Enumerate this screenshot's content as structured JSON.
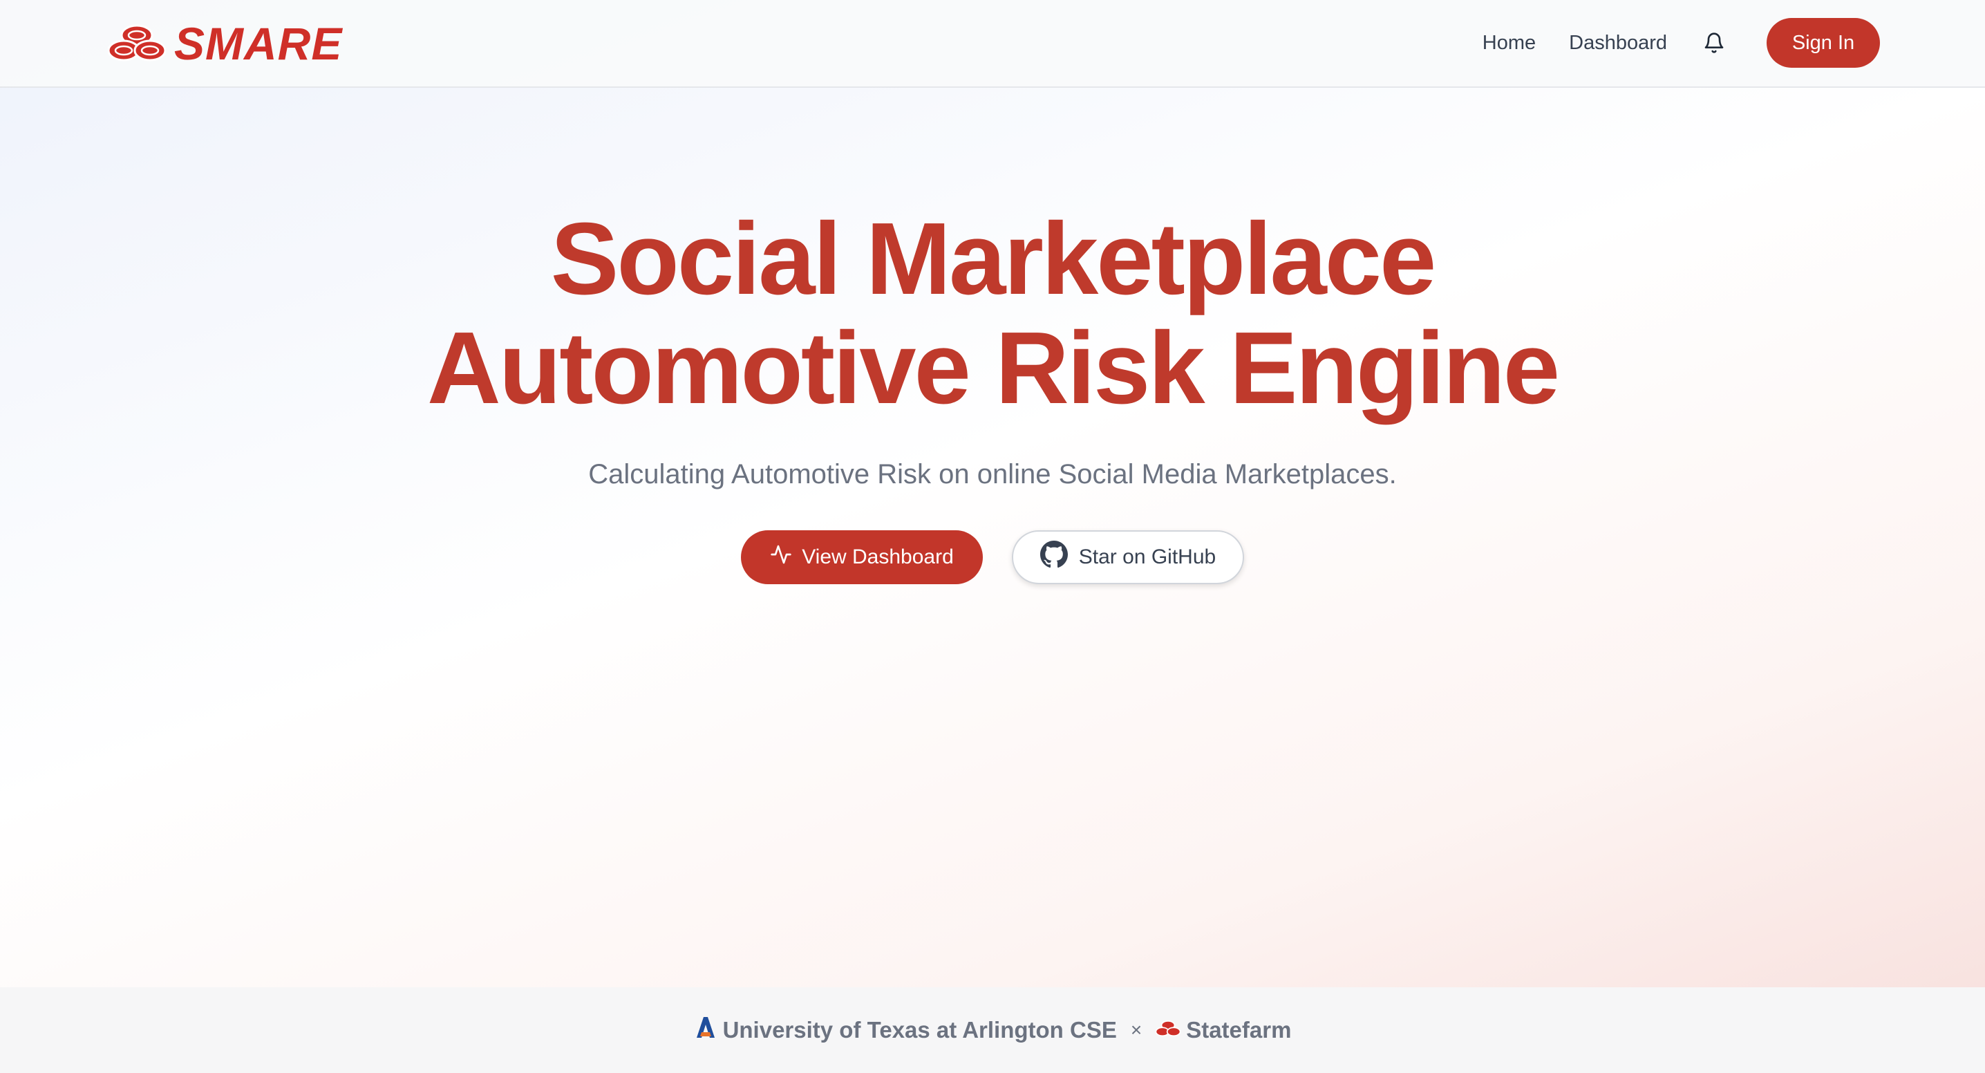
{
  "header": {
    "logo_text": "SMARE",
    "logo_icon": "statefarm-ovals-icon",
    "nav": [
      {
        "label": "Home"
      },
      {
        "label": "Dashboard"
      }
    ],
    "bell_icon": "bell-icon",
    "sign_in_label": "Sign In"
  },
  "hero": {
    "title_line1": "Social Marketplace",
    "title_line2": "Automotive Risk Engine",
    "subtitle": "Calculating Automotive Risk on online Social Media Marketplaces.",
    "primary_button": {
      "label": "View Dashboard",
      "icon": "activity-pulse-icon"
    },
    "secondary_button": {
      "label": "Star on GitHub",
      "icon": "github-icon"
    }
  },
  "footer": {
    "left_label": "University of Texas at Arlington CSE",
    "left_icon": "uta-a-logo-icon",
    "separator": "×",
    "right_label": "Statefarm",
    "right_icon": "statefarm-ovals-icon"
  },
  "colors": {
    "brand_red": "#c2362a",
    "logo_red": "#cf2f28",
    "title_red": "#bf3a2c",
    "text_gray": "#6b7280"
  }
}
